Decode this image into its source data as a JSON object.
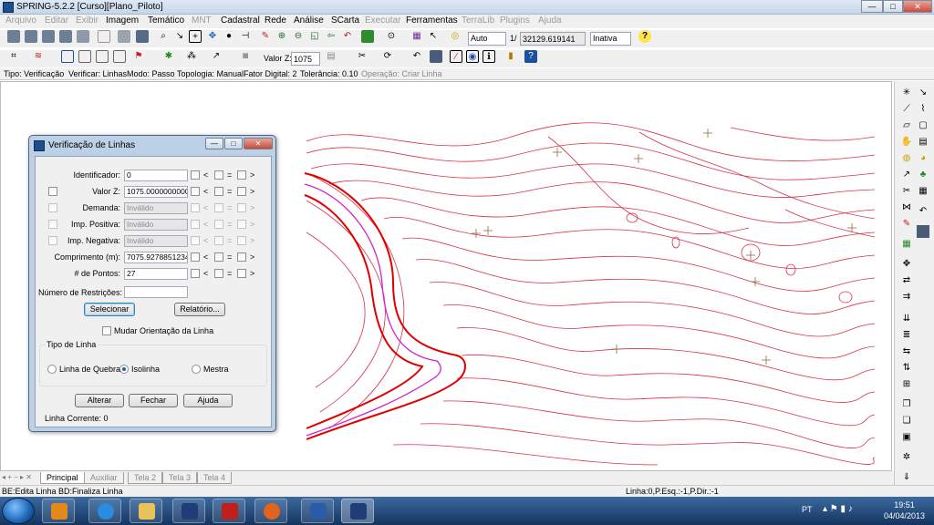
{
  "window": {
    "title": "SPRING-5.2.2 [Curso][Plano_Piloto]",
    "minimize": "—",
    "maximize": "□",
    "close": "✕"
  },
  "menu": [
    "Arquivo",
    "Editar",
    "Exibir",
    "Imagem",
    "Temático",
    "MNT",
    "Cadastral",
    "Rede",
    "Análise",
    "SCarta",
    "Executar",
    "Ferramentas",
    "TerraLib",
    "Plugins",
    "Ajuda"
  ],
  "menu_enabled": [
    false,
    false,
    false,
    true,
    true,
    false,
    true,
    true,
    true,
    true,
    false,
    true,
    false,
    false,
    false
  ],
  "toolbar": {
    "scale_mode": "Auto",
    "scale_prefix": "1/",
    "scale_value": "32129.619141",
    "state_select": "Inativa",
    "help_icon": "?"
  },
  "toolbar2": {
    "valor_z_label": "Valor Z:",
    "valor_z_value": "1075"
  },
  "status": {
    "tipo": "Tipo: Verificação",
    "verificar": "Verificar: Linhas",
    "modo": "Modo: Passo",
    "topologia": "Topologia: Manual",
    "fator": "Fator Digital: 2",
    "tolerancia": "Tolerância: 0.10",
    "operacao": "Operação: Criar Linha"
  },
  "tabs": [
    "Principal",
    "Auxiliar",
    "Tela 2",
    "Tela 3",
    "Tela 4"
  ],
  "bottom": {
    "left": "BE:Edita Linha  BD:Finaliza Linha",
    "right": "Linha:0,P.Esq.:-1,P.Dir.:-1"
  },
  "taskbar": {
    "lang": "PT",
    "time": "19:51",
    "date": "04/04/2013"
  },
  "dialog": {
    "title": "Verificação de Linhas",
    "rows": [
      {
        "label": "Identificador:",
        "value": "0",
        "has_check": false,
        "disabled": false
      },
      {
        "label": "Valor Z:",
        "value": "1075.0000000000",
        "has_check": true,
        "disabled": false
      },
      {
        "label": "Demanda:",
        "value": "Inválido",
        "has_check": true,
        "disabled": true
      },
      {
        "label": "Imp. Positiva:",
        "value": "Inválido",
        "has_check": true,
        "disabled": true
      },
      {
        "label": "Imp. Negativa:",
        "value": "Inválido",
        "has_check": true,
        "disabled": true
      },
      {
        "label": "Comprimento (m):",
        "value": "7075.9278851234",
        "has_check": false,
        "disabled": false
      },
      {
        "label": "# de Pontos:",
        "value": "27",
        "has_check": false,
        "disabled": false
      }
    ],
    "ops": [
      "<",
      "=",
      ">"
    ],
    "restricoes_label": "Número de Restrições:",
    "selecionar": "Selecionar",
    "relatorio": "Relatório...",
    "mudar_orientacao": "Mudar Orientação da Linha",
    "tipo_linha_label": "Tipo de Linha",
    "radio_options": [
      "Linha de Quebra",
      "Isolinha",
      "Mestra"
    ],
    "radio_selected": "Isolinha",
    "alterar": "Alterar",
    "fechar": "Fechar",
    "ajuda": "Ajuda",
    "linha_corrente": "Linha Corrente: 0"
  },
  "colors": {
    "contour": "#d9304a",
    "selected_line": "#e00000",
    "selected_mid": "#d020d0",
    "title_bg": "#c6d6ea",
    "taskbar": "#1f4a7c"
  }
}
